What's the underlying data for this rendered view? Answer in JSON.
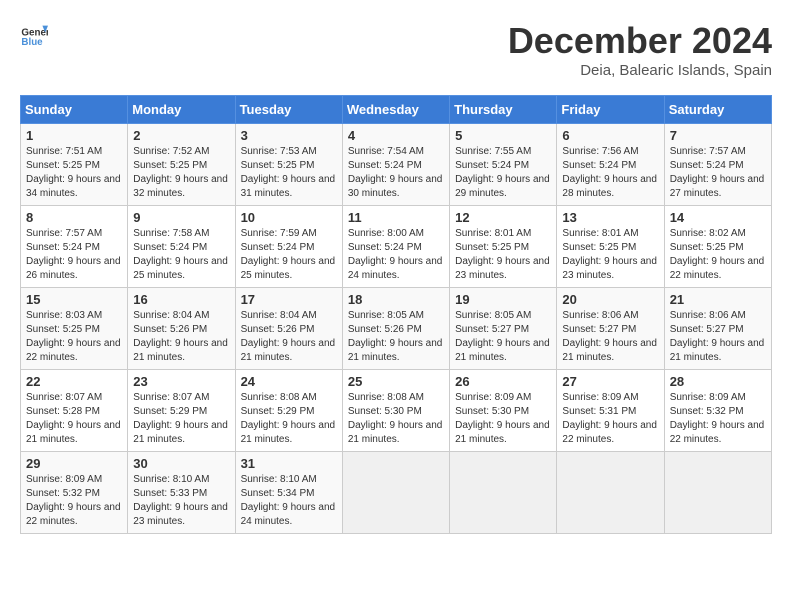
{
  "header": {
    "logo_line1": "General",
    "logo_line2": "Blue",
    "month_title": "December 2024",
    "location": "Deia, Balearic Islands, Spain"
  },
  "weekdays": [
    "Sunday",
    "Monday",
    "Tuesday",
    "Wednesday",
    "Thursday",
    "Friday",
    "Saturday"
  ],
  "weeks": [
    [
      {
        "day": "1",
        "sunrise": "Sunrise: 7:51 AM",
        "sunset": "Sunset: 5:25 PM",
        "daylight": "Daylight: 9 hours and 34 minutes."
      },
      {
        "day": "2",
        "sunrise": "Sunrise: 7:52 AM",
        "sunset": "Sunset: 5:25 PM",
        "daylight": "Daylight: 9 hours and 32 minutes."
      },
      {
        "day": "3",
        "sunrise": "Sunrise: 7:53 AM",
        "sunset": "Sunset: 5:25 PM",
        "daylight": "Daylight: 9 hours and 31 minutes."
      },
      {
        "day": "4",
        "sunrise": "Sunrise: 7:54 AM",
        "sunset": "Sunset: 5:24 PM",
        "daylight": "Daylight: 9 hours and 30 minutes."
      },
      {
        "day": "5",
        "sunrise": "Sunrise: 7:55 AM",
        "sunset": "Sunset: 5:24 PM",
        "daylight": "Daylight: 9 hours and 29 minutes."
      },
      {
        "day": "6",
        "sunrise": "Sunrise: 7:56 AM",
        "sunset": "Sunset: 5:24 PM",
        "daylight": "Daylight: 9 hours and 28 minutes."
      },
      {
        "day": "7",
        "sunrise": "Sunrise: 7:57 AM",
        "sunset": "Sunset: 5:24 PM",
        "daylight": "Daylight: 9 hours and 27 minutes."
      }
    ],
    [
      {
        "day": "8",
        "sunrise": "Sunrise: 7:57 AM",
        "sunset": "Sunset: 5:24 PM",
        "daylight": "Daylight: 9 hours and 26 minutes."
      },
      {
        "day": "9",
        "sunrise": "Sunrise: 7:58 AM",
        "sunset": "Sunset: 5:24 PM",
        "daylight": "Daylight: 9 hours and 25 minutes."
      },
      {
        "day": "10",
        "sunrise": "Sunrise: 7:59 AM",
        "sunset": "Sunset: 5:24 PM",
        "daylight": "Daylight: 9 hours and 25 minutes."
      },
      {
        "day": "11",
        "sunrise": "Sunrise: 8:00 AM",
        "sunset": "Sunset: 5:24 PM",
        "daylight": "Daylight: 9 hours and 24 minutes."
      },
      {
        "day": "12",
        "sunrise": "Sunrise: 8:01 AM",
        "sunset": "Sunset: 5:25 PM",
        "daylight": "Daylight: 9 hours and 23 minutes."
      },
      {
        "day": "13",
        "sunrise": "Sunrise: 8:01 AM",
        "sunset": "Sunset: 5:25 PM",
        "daylight": "Daylight: 9 hours and 23 minutes."
      },
      {
        "day": "14",
        "sunrise": "Sunrise: 8:02 AM",
        "sunset": "Sunset: 5:25 PM",
        "daylight": "Daylight: 9 hours and 22 minutes."
      }
    ],
    [
      {
        "day": "15",
        "sunrise": "Sunrise: 8:03 AM",
        "sunset": "Sunset: 5:25 PM",
        "daylight": "Daylight: 9 hours and 22 minutes."
      },
      {
        "day": "16",
        "sunrise": "Sunrise: 8:04 AM",
        "sunset": "Sunset: 5:26 PM",
        "daylight": "Daylight: 9 hours and 21 minutes."
      },
      {
        "day": "17",
        "sunrise": "Sunrise: 8:04 AM",
        "sunset": "Sunset: 5:26 PM",
        "daylight": "Daylight: 9 hours and 21 minutes."
      },
      {
        "day": "18",
        "sunrise": "Sunrise: 8:05 AM",
        "sunset": "Sunset: 5:26 PM",
        "daylight": "Daylight: 9 hours and 21 minutes."
      },
      {
        "day": "19",
        "sunrise": "Sunrise: 8:05 AM",
        "sunset": "Sunset: 5:27 PM",
        "daylight": "Daylight: 9 hours and 21 minutes."
      },
      {
        "day": "20",
        "sunrise": "Sunrise: 8:06 AM",
        "sunset": "Sunset: 5:27 PM",
        "daylight": "Daylight: 9 hours and 21 minutes."
      },
      {
        "day": "21",
        "sunrise": "Sunrise: 8:06 AM",
        "sunset": "Sunset: 5:27 PM",
        "daylight": "Daylight: 9 hours and 21 minutes."
      }
    ],
    [
      {
        "day": "22",
        "sunrise": "Sunrise: 8:07 AM",
        "sunset": "Sunset: 5:28 PM",
        "daylight": "Daylight: 9 hours and 21 minutes."
      },
      {
        "day": "23",
        "sunrise": "Sunrise: 8:07 AM",
        "sunset": "Sunset: 5:29 PM",
        "daylight": "Daylight: 9 hours and 21 minutes."
      },
      {
        "day": "24",
        "sunrise": "Sunrise: 8:08 AM",
        "sunset": "Sunset: 5:29 PM",
        "daylight": "Daylight: 9 hours and 21 minutes."
      },
      {
        "day": "25",
        "sunrise": "Sunrise: 8:08 AM",
        "sunset": "Sunset: 5:30 PM",
        "daylight": "Daylight: 9 hours and 21 minutes."
      },
      {
        "day": "26",
        "sunrise": "Sunrise: 8:09 AM",
        "sunset": "Sunset: 5:30 PM",
        "daylight": "Daylight: 9 hours and 21 minutes."
      },
      {
        "day": "27",
        "sunrise": "Sunrise: 8:09 AM",
        "sunset": "Sunset: 5:31 PM",
        "daylight": "Daylight: 9 hours and 22 minutes."
      },
      {
        "day": "28",
        "sunrise": "Sunrise: 8:09 AM",
        "sunset": "Sunset: 5:32 PM",
        "daylight": "Daylight: 9 hours and 22 minutes."
      }
    ],
    [
      {
        "day": "29",
        "sunrise": "Sunrise: 8:09 AM",
        "sunset": "Sunset: 5:32 PM",
        "daylight": "Daylight: 9 hours and 22 minutes."
      },
      {
        "day": "30",
        "sunrise": "Sunrise: 8:10 AM",
        "sunset": "Sunset: 5:33 PM",
        "daylight": "Daylight: 9 hours and 23 minutes."
      },
      {
        "day": "31",
        "sunrise": "Sunrise: 8:10 AM",
        "sunset": "Sunset: 5:34 PM",
        "daylight": "Daylight: 9 hours and 24 minutes."
      },
      null,
      null,
      null,
      null
    ]
  ]
}
